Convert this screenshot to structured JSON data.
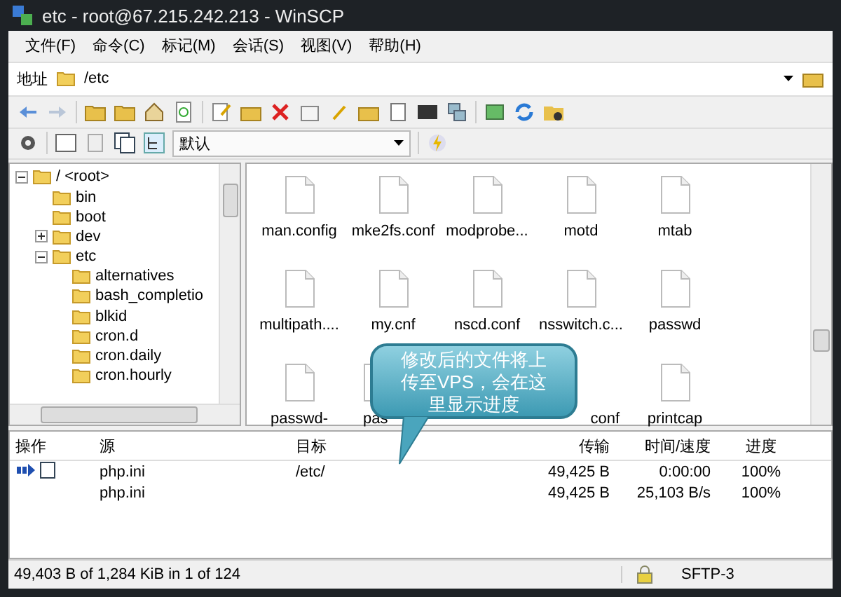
{
  "window": {
    "title": "etc - root@67.215.242.213 - WinSCP"
  },
  "menu": [
    "文件(F)",
    "命令(C)",
    "标记(M)",
    "会话(S)",
    "视图(V)",
    "帮助(H)"
  ],
  "address": {
    "label": "地址",
    "value": "/etc"
  },
  "toolbar": {
    "preset": "默认"
  },
  "tree": [
    {
      "name": "/ <root>",
      "expanded": true,
      "children": [
        {
          "name": "bin"
        },
        {
          "name": "boot"
        },
        {
          "name": "dev",
          "expanded": false
        },
        {
          "name": "etc",
          "expanded": true,
          "children": [
            {
              "name": "alternatives"
            },
            {
              "name": "bash_completio"
            },
            {
              "name": "blkid"
            },
            {
              "name": "cron.d"
            },
            {
              "name": "cron.daily"
            },
            {
              "name": "cron.hourly"
            }
          ]
        }
      ]
    }
  ],
  "files": [
    [
      {
        "name": "man.config"
      },
      {
        "name": "mke2fs.conf"
      },
      {
        "name": "modprobe..."
      },
      {
        "name": "motd"
      },
      {
        "name": "mtab"
      }
    ],
    [
      {
        "name": "multipath...."
      },
      {
        "name": "my.cnf"
      },
      {
        "name": "nscd.conf"
      },
      {
        "name": "nsswitch.c..."
      },
      {
        "name": "passwd"
      }
    ],
    [
      {
        "name": "passwd-"
      },
      {
        "name": "pas"
      },
      {
        "kind": "covered"
      },
      {
        "name": "conf",
        "kind": "partial"
      },
      {
        "name": "printcap"
      }
    ]
  ],
  "callout": {
    "text": "修改后的文件将上传至VPS，会在这里显示进度"
  },
  "queue": {
    "columns": [
      "操作",
      "源",
      "目标",
      "传输",
      "时间/速度",
      "进度"
    ],
    "rows": [
      {
        "icon": true,
        "source": "php.ini",
        "target": "/etc/",
        "transferred": "49,425 B",
        "time_speed": "0:00:00",
        "progress": "100%"
      },
      {
        "icon": false,
        "source": "php.ini",
        "transferred": "49,425 B",
        "time_speed": "25,103 B/s",
        "progress": "100%"
      }
    ]
  },
  "status_bar": {
    "summary": "49,403 B of 1,284 KiB in 1 of 124",
    "protocol": "SFTP-3"
  }
}
